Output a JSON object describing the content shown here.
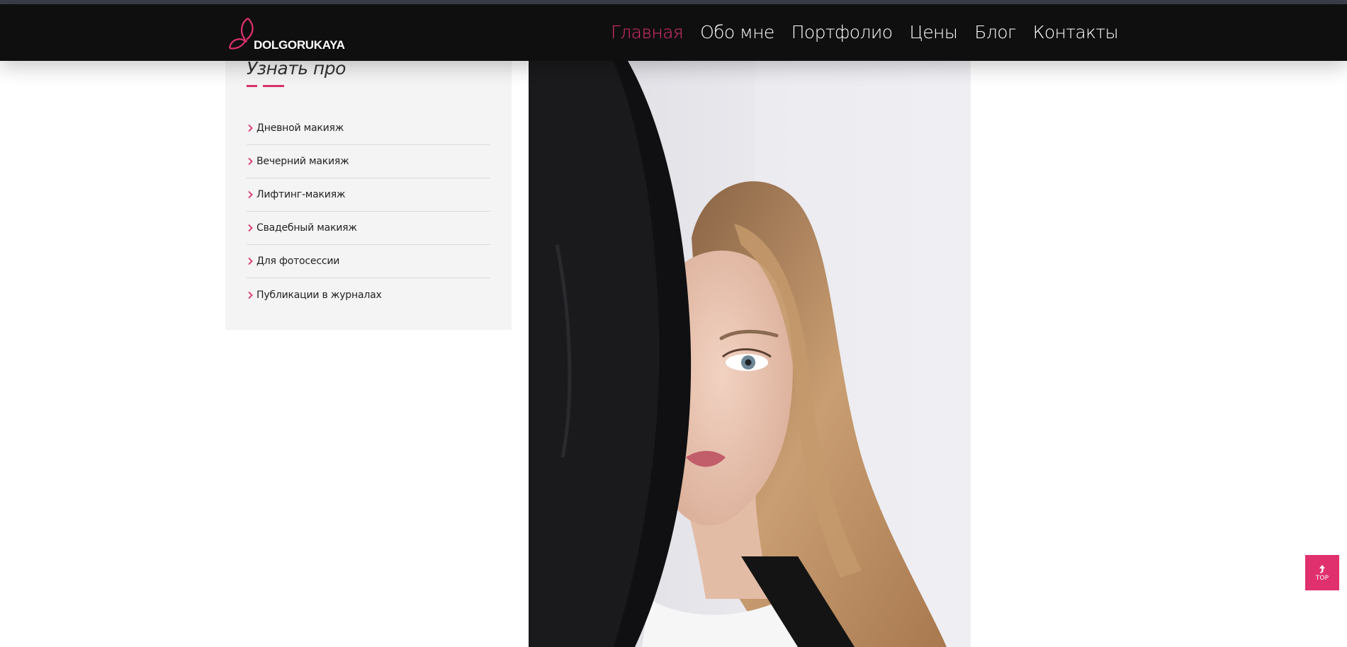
{
  "brand": {
    "name": "DOLGORUKAYA",
    "accent_color": "#e0306e",
    "logo_icon": "butterfly-icon"
  },
  "nav": {
    "items": [
      {
        "label": "Главная",
        "active": true
      },
      {
        "label": "Обо мне",
        "active": false
      },
      {
        "label": "Портфолио",
        "active": false
      },
      {
        "label": "Цены",
        "active": false
      },
      {
        "label": "Блог",
        "active": false
      },
      {
        "label": "Контакты",
        "active": false
      }
    ]
  },
  "sidebar": {
    "title": "Узнать про",
    "items": [
      {
        "label": "Дневной макияж",
        "icon": "chevron-right-icon"
      },
      {
        "label": "Вечерний макияж",
        "icon": "chevron-right-icon"
      },
      {
        "label": "Лифтинг-макияж",
        "icon": "chevron-right-icon"
      },
      {
        "label": "Свадебный макияж",
        "icon": "chevron-right-icon"
      },
      {
        "label": "Для фотосессии",
        "icon": "chevron-right-icon"
      },
      {
        "label": "Публикации в журналах",
        "icon": "chevron-right-icon"
      }
    ]
  },
  "back_to_top": {
    "label": "TOP",
    "icon": "arrow-up-icon"
  }
}
